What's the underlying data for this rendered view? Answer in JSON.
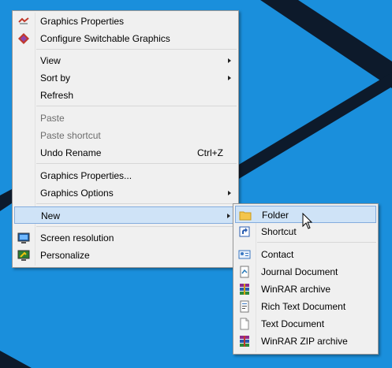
{
  "context_menu": {
    "items": [
      {
        "label": "Graphics Properties"
      },
      {
        "label": "Configure Switchable Graphics"
      },
      {
        "label": "View"
      },
      {
        "label": "Sort by"
      },
      {
        "label": "Refresh"
      },
      {
        "label": "Paste"
      },
      {
        "label": "Paste shortcut"
      },
      {
        "label": "Undo Rename",
        "shortcut": "Ctrl+Z"
      },
      {
        "label": "Graphics Properties..."
      },
      {
        "label": "Graphics Options"
      },
      {
        "label": "New"
      },
      {
        "label": "Screen resolution"
      },
      {
        "label": "Personalize"
      }
    ]
  },
  "new_submenu": {
    "items": [
      {
        "label": "Folder"
      },
      {
        "label": "Shortcut"
      },
      {
        "label": "Contact"
      },
      {
        "label": "Journal Document"
      },
      {
        "label": "WinRAR archive"
      },
      {
        "label": "Rich Text Document"
      },
      {
        "label": "Text Document"
      },
      {
        "label": "WinRAR ZIP archive"
      }
    ]
  },
  "colors": {
    "desktop_background": "#1a8fdc",
    "menu_background": "#f0f0f0",
    "hover_background": "#cfe3f7",
    "hover_border": "#84acdd"
  }
}
